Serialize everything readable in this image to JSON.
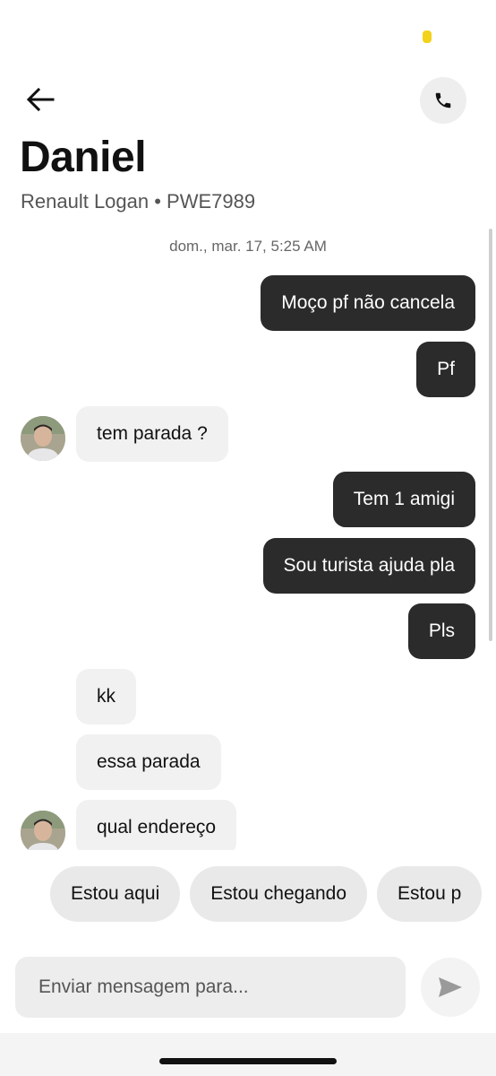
{
  "header": {
    "back_icon": "arrow-left-icon",
    "call_icon": "phone-icon",
    "title": "Daniel",
    "subtitle": "Renault Logan • PWE7989"
  },
  "chat": {
    "timestamp": "dom., mar. 17, 5:25 AM",
    "messages": [
      {
        "direction": "outgoing",
        "text": "Moço pf não cancela"
      },
      {
        "direction": "outgoing",
        "text": "Pf"
      },
      {
        "direction": "incoming",
        "text": "tem parada ?",
        "avatar": true
      },
      {
        "direction": "outgoing",
        "text": "Tem 1 amigi"
      },
      {
        "direction": "outgoing",
        "text": "Sou turista ajuda pla"
      },
      {
        "direction": "outgoing",
        "text": "Pls"
      },
      {
        "direction": "incoming",
        "text": "kk"
      },
      {
        "direction": "incoming",
        "text": "essa parada"
      },
      {
        "direction": "incoming",
        "text": "qual endereço",
        "avatar": true
      }
    ]
  },
  "quick_replies": [
    "Estou aqui",
    "Estou chegando",
    "Estou p"
  ],
  "composer": {
    "placeholder": "Enviar mensagem para...",
    "value": "",
    "send_icon": "send-icon"
  },
  "colors": {
    "outgoing_bubble": "#2b2b2b",
    "incoming_bubble": "#f1f1f1",
    "status_dot": "#f2d21b"
  }
}
